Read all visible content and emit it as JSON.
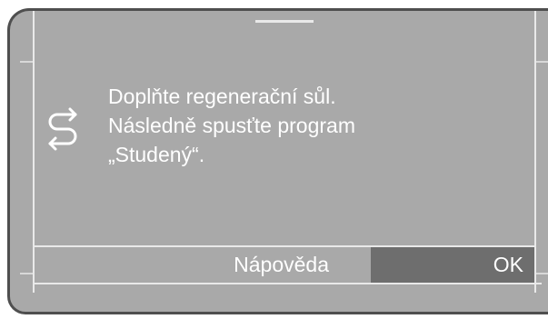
{
  "dialog": {
    "icon": "cycle-arrows-icon",
    "lines": [
      "Doplňte regenerační sůl.",
      "Následně spusťte program",
      "„Studený“."
    ]
  },
  "buttons": {
    "help_label": "Nápověda",
    "ok_label": "OK"
  },
  "colors": {
    "screen_bg": "#a9a9a9",
    "frame_line": "#e9e9e9",
    "ok_bg": "#6e6e6e",
    "text": "#ffffff"
  }
}
